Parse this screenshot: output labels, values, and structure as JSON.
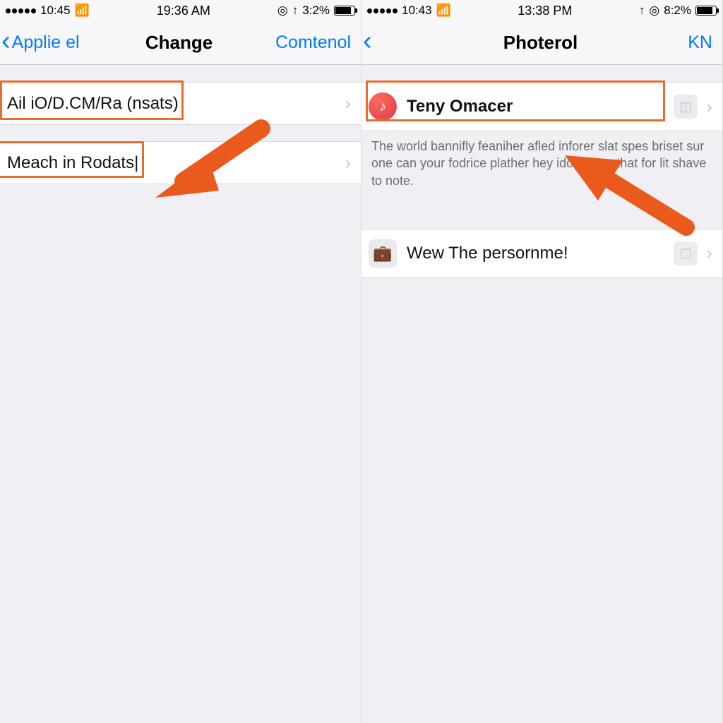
{
  "left": {
    "statusbar": {
      "carrier_time_left": "10:45",
      "center": "19:36 AM",
      "right_text": "3:2%",
      "right_icons": [
        "◎",
        "↑"
      ]
    },
    "nav": {
      "back_label": "Applie el",
      "title": "Change",
      "right_action": "Comtenol"
    },
    "rows": [
      {
        "label": "Ail iO/D.CM/Ra (nsats)"
      },
      {
        "label": "Meach in Rodats|"
      }
    ]
  },
  "right": {
    "statusbar": {
      "carrier_time_left": "10:43",
      "center": "13:38 PM",
      "right_text": "8:2%",
      "right_icons": [
        "↑",
        "◎"
      ]
    },
    "nav": {
      "title": "Photerol",
      "right_action": "KN"
    },
    "rows": [
      {
        "label": "Teny Omacer",
        "icon": "music",
        "has_badge": true
      },
      {
        "label": "Wew The persornme!",
        "icon": "briefcase",
        "has_badge": true
      }
    ],
    "section_note": "The world bannifly feaniher afled inforer slat spes briset sur one can your fodrice plather hey idoat boor that for lit shave to note."
  },
  "colors": {
    "accent": "#007aff",
    "highlight": "#e86c2c"
  }
}
